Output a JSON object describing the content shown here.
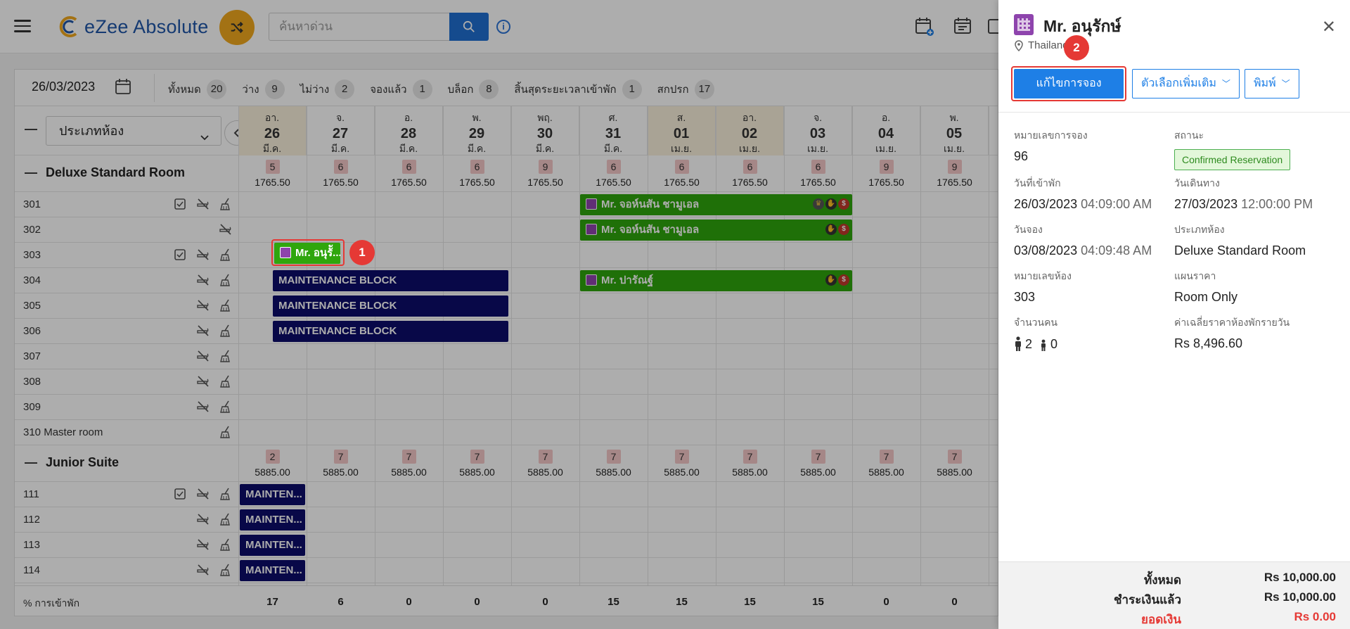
{
  "app": {
    "name": "eZee Absolute"
  },
  "search": {
    "placeholder": "ค้นหาด่วน"
  },
  "filterbar": {
    "date": "26/03/2023",
    "filters": [
      {
        "label": "ทั้งหมด",
        "count": "20"
      },
      {
        "label": "ว่าง",
        "count": "9"
      },
      {
        "label": "ไม่ว่าง",
        "count": "2"
      },
      {
        "label": "จองแล้ว",
        "count": "1"
      },
      {
        "label": "บล็อก",
        "count": "8"
      },
      {
        "label": "สิ้นสุดระยะเวลาเข้าพัก",
        "count": "1"
      },
      {
        "label": "สกปรก",
        "count": "17"
      }
    ]
  },
  "grid": {
    "room_type_select": "ประเภทห้อง",
    "days": [
      {
        "dow": "อา.",
        "num": "26",
        "mon": "มี.ค.",
        "weekend": true
      },
      {
        "dow": "จ.",
        "num": "27",
        "mon": "มี.ค.",
        "weekend": false
      },
      {
        "dow": "อ.",
        "num": "28",
        "mon": "มี.ค.",
        "weekend": false
      },
      {
        "dow": "พ.",
        "num": "29",
        "mon": "มี.ค.",
        "weekend": false
      },
      {
        "dow": "พฤ.",
        "num": "30",
        "mon": "มี.ค.",
        "weekend": false
      },
      {
        "dow": "ศ.",
        "num": "31",
        "mon": "มี.ค.",
        "weekend": false
      },
      {
        "dow": "ส.",
        "num": "01",
        "mon": "เม.ย.",
        "weekend": true
      },
      {
        "dow": "อา.",
        "num": "02",
        "mon": "เม.ย.",
        "weekend": true
      },
      {
        "dow": "จ.",
        "num": "03",
        "mon": "เม.ย.",
        "weekend": false
      },
      {
        "dow": "อ.",
        "num": "04",
        "mon": "เม.ย.",
        "weekend": false
      },
      {
        "dow": "พ.",
        "num": "05",
        "mon": "เม.ย.",
        "weekend": false
      }
    ],
    "groups": [
      {
        "title": "Deluxe Standard Room",
        "avail": [
          "5",
          "6",
          "6",
          "6",
          "9",
          "6",
          "6",
          "6",
          "6",
          "9",
          "9"
        ],
        "price": "1765.50",
        "rooms": [
          "301",
          "302",
          "303",
          "304",
          "305",
          "306",
          "307",
          "308",
          "309",
          "310 Master room"
        ]
      },
      {
        "title": "Junior Suite",
        "avail": [
          "2",
          "7",
          "7",
          "7",
          "7",
          "7",
          "7",
          "7",
          "7",
          "7",
          "7"
        ],
        "price": "5885.00",
        "rooms": [
          "111",
          "112",
          "113",
          "114"
        ]
      }
    ],
    "bookings": {
      "b301": "Mr. จอห์นสัน ชามูเอล",
      "b302": "Mr. จอห์นสัน ชามูเอล",
      "b303": "Mr. อนุรัั...",
      "b304a": "MAINTENANCE BLOCK",
      "b304b": "Mr. ปารัณฐ์",
      "b305": "MAINTENANCE BLOCK",
      "b306": "MAINTENANCE BLOCK",
      "b111": "MAINTEN...",
      "b112": "MAINTEN...",
      "b113": "MAINTEN...",
      "b114": "MAINTEN..."
    },
    "occupancy_label": "% การเข้าพัก",
    "occupancy": [
      "17",
      "6",
      "0",
      "0",
      "0",
      "15",
      "15",
      "15",
      "15",
      "0",
      "0"
    ]
  },
  "drawer": {
    "guest": "Mr. อนุรักษ์",
    "location": "Thailand",
    "edit_button": "แก้ไขการจอง",
    "more_options": "ตัวเลือกเพิ่มเติม",
    "print": "พิมพ์",
    "details": {
      "res_no_label": "หมายเลขการจอง",
      "res_no": "96",
      "status_label": "สถานะ",
      "status": "Confirmed Reservation",
      "checkin_label": "วันที่เข้าพัก",
      "checkin_date": "26/03/2023",
      "checkin_time": "04:09:00 AM",
      "checkout_label": "วันเดินทาง",
      "checkout_date": "27/03/2023",
      "checkout_time": "12:00:00 PM",
      "booked_label": "วันจอง",
      "booked_date": "03/08/2023",
      "booked_time": "04:09:48 AM",
      "room_type_label": "ประเภทห้อง",
      "room_type": "Deluxe Standard Room",
      "room_no_label": "หมายเลขห้อง",
      "room_no": "303",
      "rate_plan_label": "แผนราคา",
      "rate_plan": "Room Only",
      "pax_label": "จำนวนคน",
      "adults": "2",
      "children": "0",
      "avg_rate_label": "ค่าเฉลี่ยราคาห้องพักรายวัน",
      "avg_rate": "Rs 8,496.60"
    },
    "summary": {
      "total_label": "ทั้งหมด",
      "total": "Rs 10,000.00",
      "paid_label": "ชำระเงินแล้ว",
      "paid": "Rs 10,000.00",
      "balance_label": "ยอดเงิน",
      "balance": "Rs 0.00"
    }
  },
  "annotations": {
    "step1": "1",
    "step2": "2"
  },
  "colors": {
    "accent": "#1e7fe6",
    "booking_green": "#2fa60d",
    "block_navy": "#0d0d6b",
    "highlight": "#e53935",
    "brand_orange": "#f0a81e"
  }
}
